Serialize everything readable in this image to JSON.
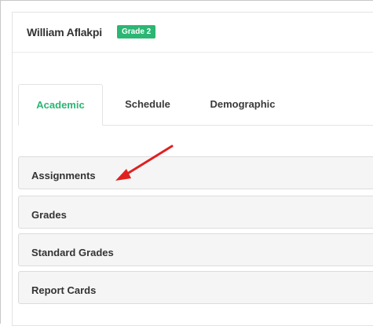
{
  "header": {
    "student_name": "William Aflakpi",
    "grade_badge": "Grade 2"
  },
  "tabs": [
    {
      "label": "Academic",
      "active": true
    },
    {
      "label": "Schedule",
      "active": false
    },
    {
      "label": "Demographic",
      "active": false
    }
  ],
  "sections": [
    {
      "label": "Assignments"
    },
    {
      "label": "Grades"
    },
    {
      "label": "Standard Grades"
    },
    {
      "label": "Report Cards"
    }
  ],
  "colors": {
    "accent": "#2bb673",
    "panel_bg": "#f5f5f5",
    "annotation_arrow": "#e02020"
  }
}
